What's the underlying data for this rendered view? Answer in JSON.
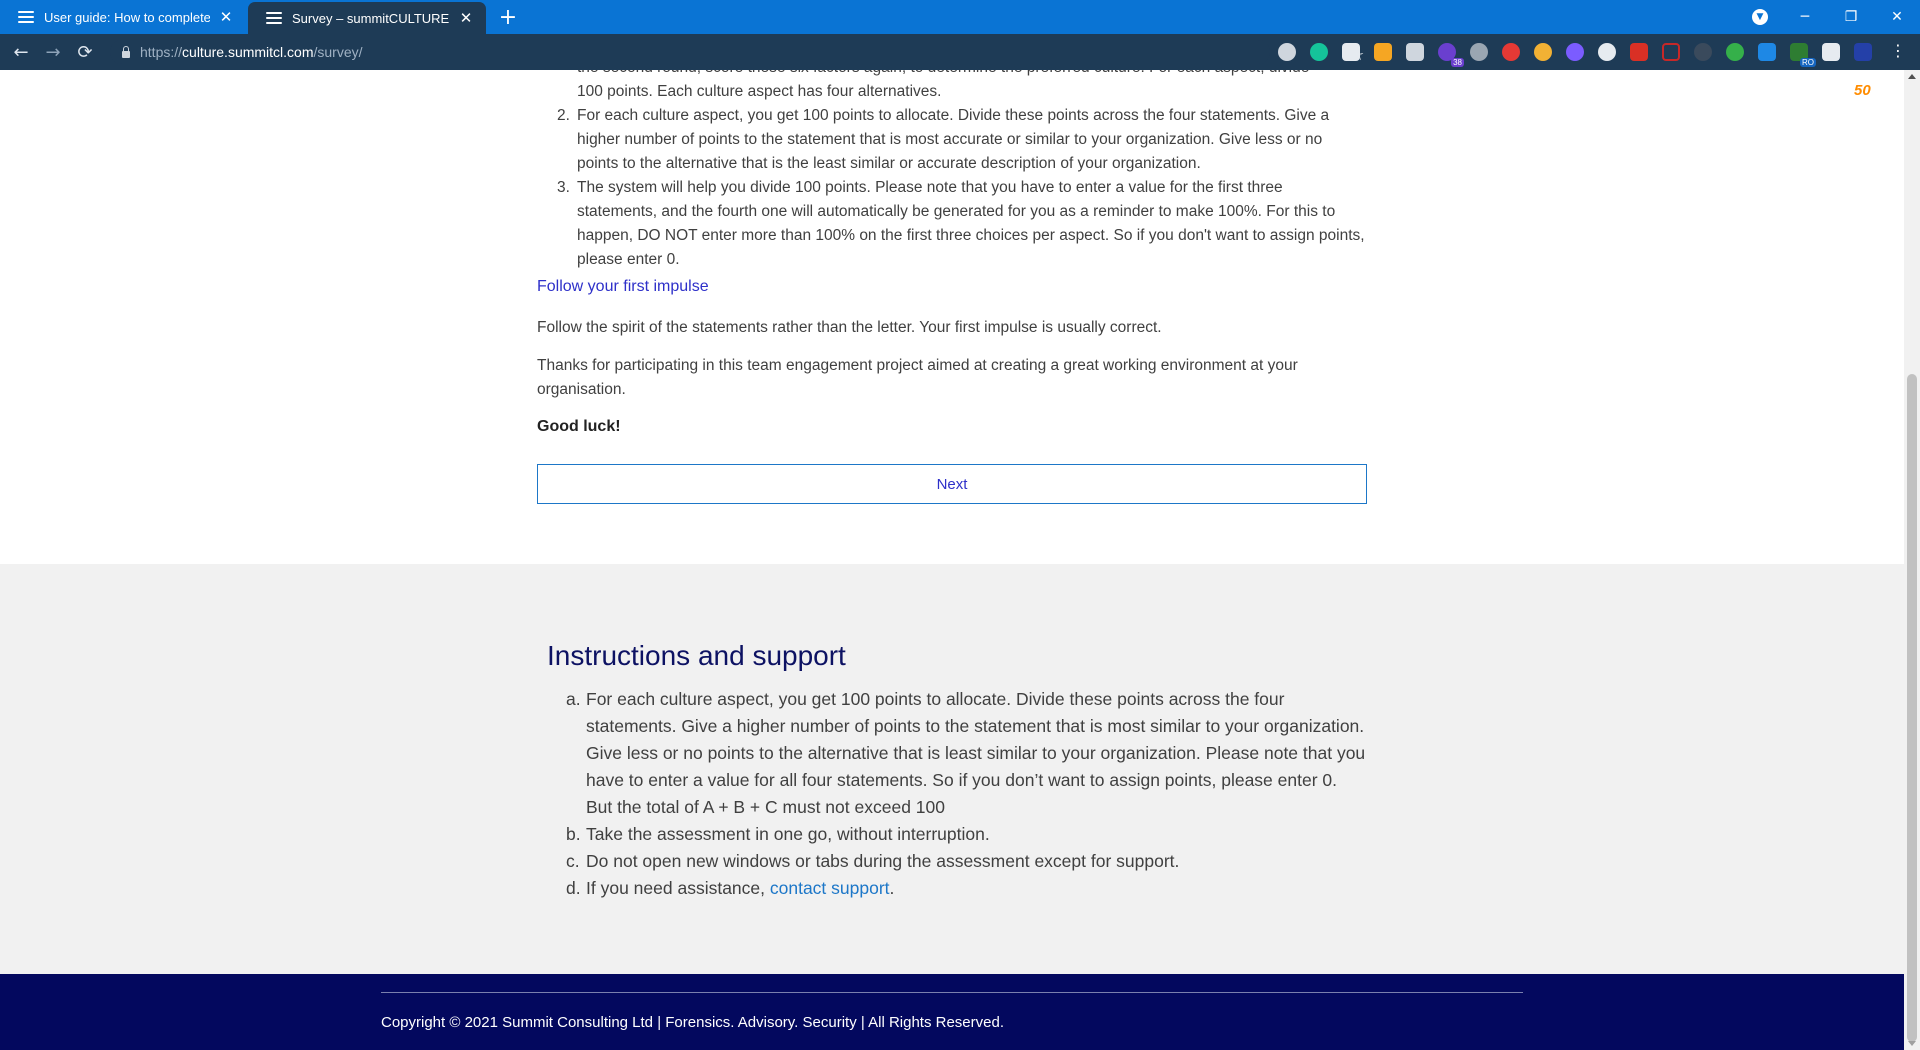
{
  "browser": {
    "tabs": [
      {
        "title": "User guide: How to complete the"
      },
      {
        "title": "Survey – summitCULTURE"
      }
    ],
    "new_tab": "+",
    "url_scheme": "https://",
    "url_host": "culture.summitcl.com",
    "url_path": "/survey/",
    "extension_badges": {
      "ext5": "38",
      "ext19": "RO"
    },
    "accent_color": "#0a74d4"
  },
  "intro": {
    "cut_line": "the second round, score these six factors again, to determine the preferred culture. For each aspect, divide",
    "first_item_tail": "100 points. Each culture aspect has four alternatives.",
    "items": [
      {
        "number": "2.",
        "text": "For each culture aspect, you get 100 points to allocate. Divide these points across the four statements. Give a higher number of points to the statement that is most accurate or similar to your organization. Give less or no points to the alternative that is the least similar or accurate description of your organization."
      },
      {
        "number": "3.",
        "text": "The system will help you divide 100 points. Please note that you have to enter a value for the first three statements, and the fourth one will automatically be generated for you as a reminder to make 100%. For this to happen, DO NOT enter more than 100% on the first three choices per aspect. So if you don't want to assign points, please enter 0."
      }
    ],
    "impulse_heading": "Follow your first impulse",
    "impulse_text": "Follow the spirit of the statements rather than the letter. Your first impulse is usually correct.",
    "thanks_text": "Thanks for participating in this team engagement project aimed at creating a great working environment at your organisation.",
    "good_luck": "Good luck!",
    "next_label": "Next"
  },
  "support": {
    "title": "Instructions and support",
    "items": [
      {
        "marker": "a.",
        "text": "For each culture aspect, you get 100 points to allocate. Divide these points across the four statements. Give a higher number of points to the statement that is most similar to your organization. Give less or no points to the alternative that is least similar to your organization. Please note that you have to enter a value for all four statements. So if you don’t want to assign points, please enter 0. But the total of A + B + C must not exceed 100"
      },
      {
        "marker": "b.",
        "text": "Take the assessment in one go, without interruption."
      },
      {
        "marker": "c.",
        "text": "Do not open new windows or tabs during the assessment except for support."
      },
      {
        "marker": "d.",
        "text_before": "If you need assistance, ",
        "link": "contact support",
        "text_after": "."
      }
    ]
  },
  "footer": {
    "copyright": "Copyright © 2021 Summit Consulting Ltd | Forensics. Advisory. Security | All Rights Reserved."
  },
  "floating_badge": "50"
}
